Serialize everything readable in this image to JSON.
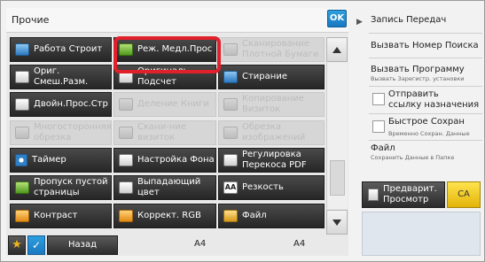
{
  "panel": {
    "title": "Прочие",
    "ok_label": "OK"
  },
  "functions": [
    {
      "label": "Работа Строит",
      "icon": "build-job-icon",
      "enabled": true
    },
    {
      "label": "Реж. Медл.Прос",
      "icon": "slow-scan-mode-icon",
      "enabled": true
    },
    {
      "label": "Сканирование\nПлотной Бумаги",
      "icon": "thick-paper-scan-icon",
      "enabled": false
    },
    {
      "label": "Ориг.\nСмеш.Разм.",
      "icon": "mixed-size-original-icon",
      "enabled": true
    },
    {
      "label": "Оригиналь.\nПодсчет",
      "icon": "original-count-icon",
      "enabled": true
    },
    {
      "label": "Стирание",
      "icon": "erase-icon",
      "enabled": true
    },
    {
      "label": "Двойн.Прос.Стр",
      "icon": "dual-page-scan-icon",
      "enabled": true
    },
    {
      "label": "Деление Книги",
      "icon": "book-divide-icon",
      "enabled": false
    },
    {
      "label": "Копирование\nВизиток",
      "icon": "card-copy-icon",
      "enabled": false
    },
    {
      "label": "Многосторонняя\nобрезка",
      "icon": "multi-crop-icon",
      "enabled": false
    },
    {
      "label": "Скани-ние\nвизиток",
      "icon": "card-scan-icon",
      "enabled": false
    },
    {
      "label": "Обрезка\nизображений",
      "icon": "image-crop-icon",
      "enabled": false
    },
    {
      "label": "Таймер",
      "icon": "timer-icon",
      "enabled": true
    },
    {
      "label": "Настройка Фона",
      "icon": "background-adjust-icon",
      "enabled": true
    },
    {
      "label": "Регулировка\nПерекоса PDF",
      "icon": "pdf-skew-icon",
      "enabled": true
    },
    {
      "label": "Пропуск пустой\nстраницы",
      "icon": "blank-page-skip-icon",
      "enabled": true
    },
    {
      "label": "Выпадающий\nцвет",
      "icon": "color-dropout-icon",
      "enabled": true
    },
    {
      "label": "Резкость",
      "icon": "sharpness-icon",
      "enabled": true
    },
    {
      "label": "Контраст",
      "icon": "contrast-icon",
      "enabled": true
    },
    {
      "label": "Коррект. RGB",
      "icon": "rgb-adjust-icon",
      "enabled": true
    },
    {
      "label": "Файл",
      "icon": "file-folder-icon",
      "enabled": true
    }
  ],
  "bottom": {
    "back_label": "Назад",
    "paper_1": "A4",
    "paper_2": "A4"
  },
  "right_panel": {
    "arrow": "▶",
    "items": [
      {
        "label": "Запись Передач",
        "sub": ""
      },
      {
        "label": "Вызвать Номер Поиска",
        "sub": ""
      },
      {
        "label": "Вызвать Программу",
        "sub": "Вызвать Зарегистр. установки"
      }
    ],
    "checks": [
      {
        "label": "Отправить\nссылку назначения",
        "sub": ""
      },
      {
        "label": "Быстрое Сохран",
        "sub": "Временно Сохран. Данные"
      }
    ],
    "file": {
      "label": "Файл",
      "sub": "Сохранить Данные в Папке"
    },
    "preview_label": "Предварит.\nПросмотр",
    "ca_label": "CA"
  }
}
